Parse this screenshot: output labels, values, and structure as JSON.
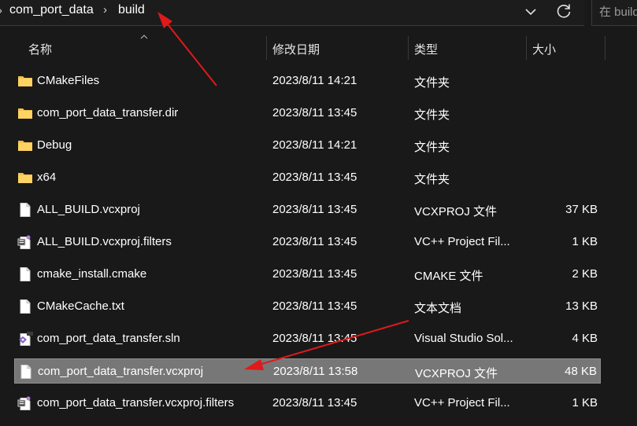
{
  "breadcrumb": {
    "items": [
      "com_port_data",
      "build"
    ],
    "separator": "›"
  },
  "search": {
    "placeholder": "在 build"
  },
  "columns": [
    "名称",
    "修改日期",
    "类型",
    "大小"
  ],
  "icons": {
    "folder": "folder-icon",
    "file": "file-icon",
    "filters": "filters-file-icon",
    "sln": "visual-studio-solution-icon"
  },
  "colors": {
    "background": "#191919",
    "selected_row": "#777777",
    "folder": "#f2c14e",
    "annotation_arrow": "#e0191b"
  },
  "files": [
    {
      "name": "CMakeFiles",
      "date": "2023/8/11 14:21",
      "type": "文件夹",
      "size": "",
      "icon": "folder",
      "selected": false
    },
    {
      "name": "com_port_data_transfer.dir",
      "date": "2023/8/11 13:45",
      "type": "文件夹",
      "size": "",
      "icon": "folder",
      "selected": false
    },
    {
      "name": "Debug",
      "date": "2023/8/11 14:21",
      "type": "文件夹",
      "size": "",
      "icon": "folder",
      "selected": false
    },
    {
      "name": "x64",
      "date": "2023/8/11 13:45",
      "type": "文件夹",
      "size": "",
      "icon": "folder",
      "selected": false
    },
    {
      "name": "ALL_BUILD.vcxproj",
      "date": "2023/8/11 13:45",
      "type": "VCXPROJ 文件",
      "size": "37 KB",
      "icon": "file",
      "selected": false
    },
    {
      "name": "ALL_BUILD.vcxproj.filters",
      "date": "2023/8/11 13:45",
      "type": "VC++ Project Fil...",
      "size": "1 KB",
      "icon": "filters",
      "selected": false
    },
    {
      "name": "cmake_install.cmake",
      "date": "2023/8/11 13:45",
      "type": "CMAKE 文件",
      "size": "2 KB",
      "icon": "file",
      "selected": false
    },
    {
      "name": "CMakeCache.txt",
      "date": "2023/8/11 13:45",
      "type": "文本文档",
      "size": "13 KB",
      "icon": "file",
      "selected": false
    },
    {
      "name": "com_port_data_transfer.sln",
      "date": "2023/8/11 13:45",
      "type": "Visual Studio Sol...",
      "size": "4 KB",
      "icon": "sln",
      "selected": false
    },
    {
      "name": "com_port_data_transfer.vcxproj",
      "date": "2023/8/11 13:58",
      "type": "VCXPROJ 文件",
      "size": "48 KB",
      "icon": "file",
      "selected": true
    },
    {
      "name": "com_port_data_transfer.vcxproj.filters",
      "date": "2023/8/11 13:45",
      "type": "VC++ Project Fil...",
      "size": "1 KB",
      "icon": "filters",
      "selected": false
    }
  ]
}
